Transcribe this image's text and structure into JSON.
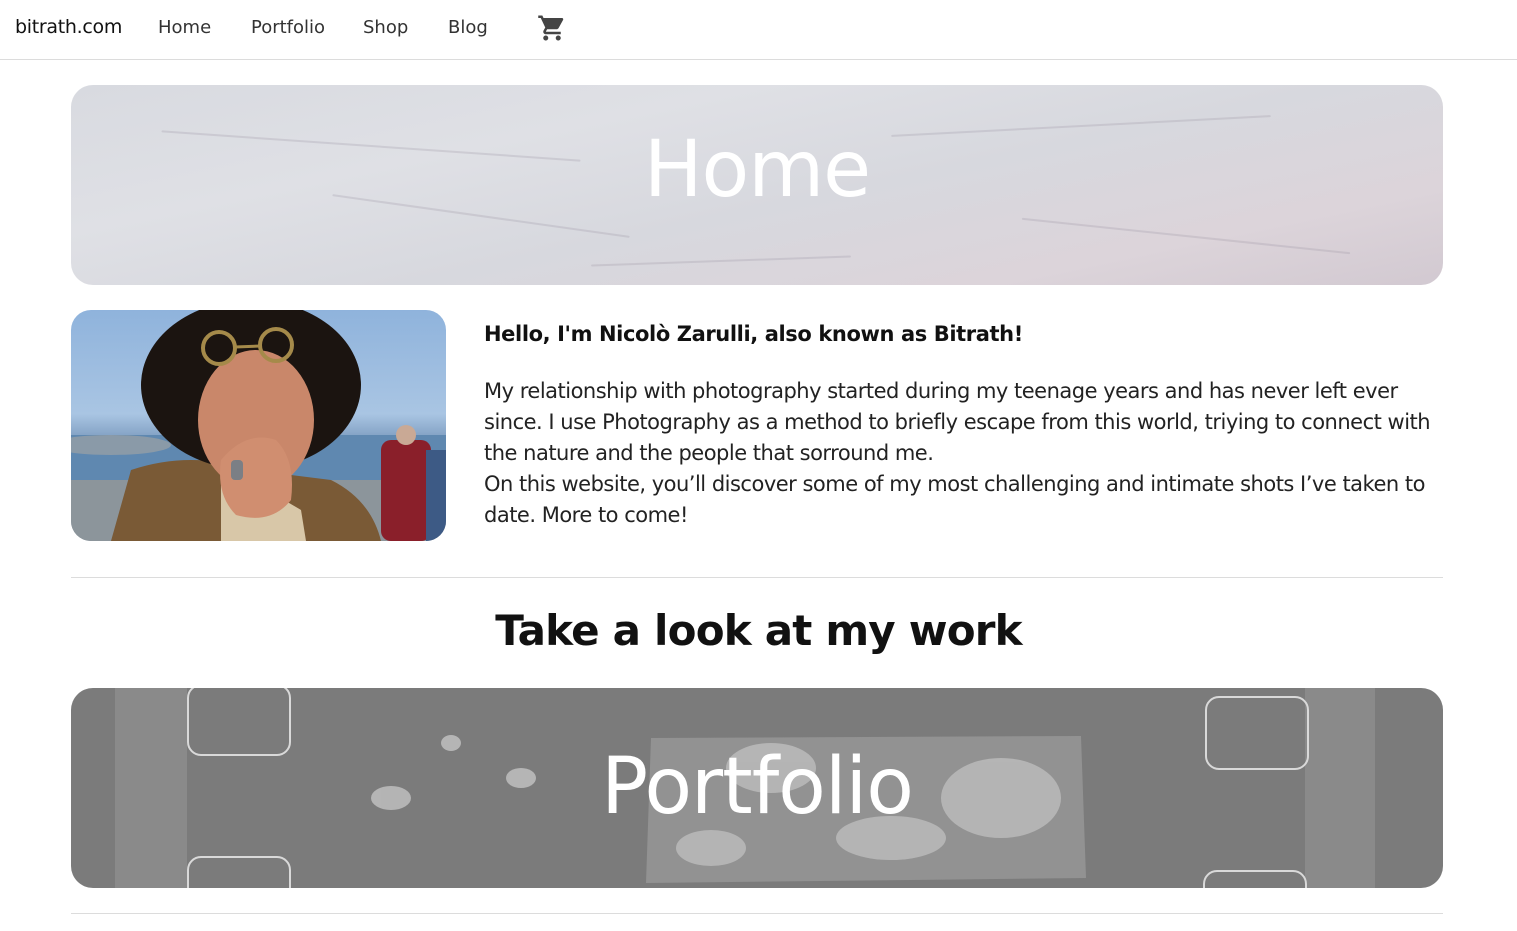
{
  "nav": {
    "brand": "bitrath.com",
    "links": [
      "Home",
      "Portfolio",
      "Shop",
      "Blog"
    ],
    "cart_icon": "shopping-cart-icon"
  },
  "hero": {
    "title": "Home"
  },
  "about": {
    "intro": "Hello, I'm Nicolò Zarulli, also known as Bitrath!",
    "paragraph1": "My relationship with photography started during my teenage years and has never left ever since. I use Photography as a method to briefly escape from this world, triying to connect with the nature and the people that sorround me.",
    "paragraph2": "On this website, you’ll discover some of my most challenging and intimate shots I’ve taken to date. More to come!"
  },
  "work_section": {
    "title": "Take a look at my work"
  },
  "portfolio_banner": {
    "title": "Portfolio"
  },
  "colors": {
    "text": "#111111",
    "divider": "#dcdcdc",
    "banner_gray": "#7b7b7b"
  }
}
